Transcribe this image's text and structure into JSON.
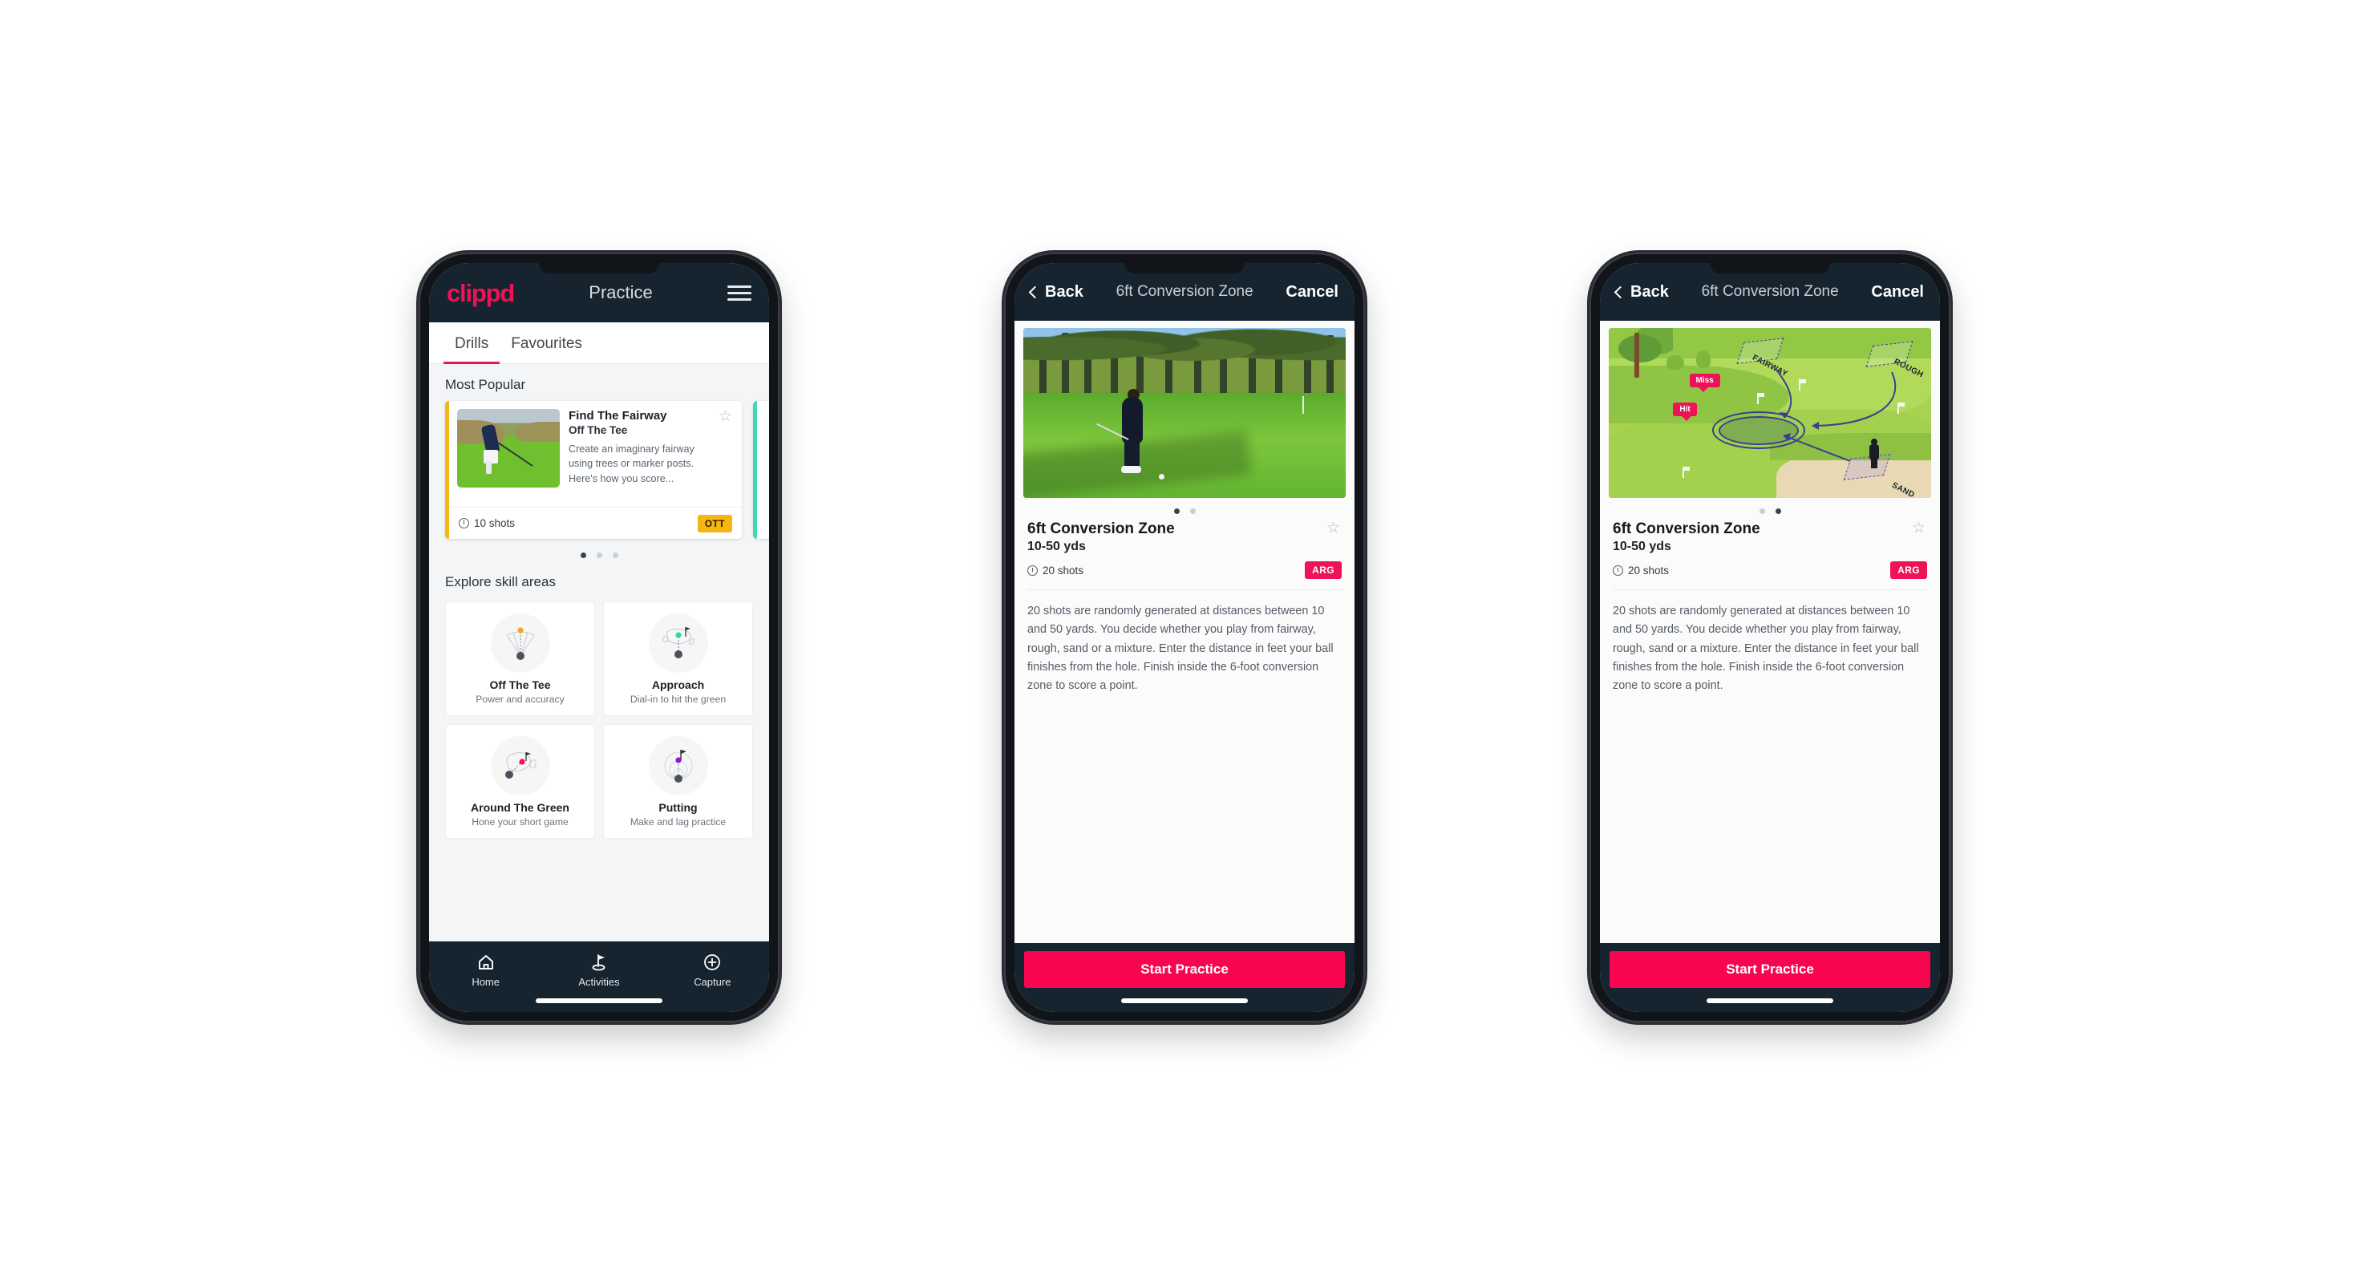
{
  "phone1": {
    "appbar": {
      "logo": "clippd",
      "title": "Practice",
      "menu_icon": "hamburger-icon"
    },
    "tabs": [
      {
        "label": "Drills",
        "active": true
      },
      {
        "label": "Favourites",
        "active": false
      }
    ],
    "sections": {
      "most_popular": "Most Popular",
      "explore": "Explore skill areas"
    },
    "drill_card": {
      "name": "Find The Fairway",
      "category": "Off The Tee",
      "description": "Create an imaginary fairway using trees or marker posts. Here's how you score...",
      "shots": "10 shots",
      "badge": "OTT",
      "accent_color": "#f5b513",
      "star_icon": "star-outline-icon"
    },
    "carousel_dots": [
      true,
      false,
      false
    ],
    "skills": [
      {
        "name": "Off The Tee",
        "sub": "Power and accuracy",
        "icon": "tee-fan-icon",
        "dot_color": "#f5a623"
      },
      {
        "name": "Approach",
        "sub": "Dial-in to hit the green",
        "icon": "approach-green-icon",
        "dot_color": "#33d6a6"
      },
      {
        "name": "Around The Green",
        "sub": "Hone your short game",
        "icon": "chip-green-icon",
        "dot_color": "#ee1356"
      },
      {
        "name": "Putting",
        "sub": "Make and lag practice",
        "icon": "putting-rings-icon",
        "dot_color": "#8c16d6"
      }
    ],
    "tabbar": [
      {
        "label": "Home",
        "icon": "home-icon",
        "active": false
      },
      {
        "label": "Activities",
        "icon": "golf-flag-icon",
        "active": true
      },
      {
        "label": "Capture",
        "icon": "plus-circle-icon",
        "active": false
      }
    ]
  },
  "detail": {
    "nav": {
      "back": "Back",
      "title": "6ft Conversion Zone",
      "cancel": "Cancel",
      "back_icon": "chevron-left-icon"
    },
    "title": "6ft Conversion Zone",
    "yards": "10-50 yds",
    "shots": "20 shots",
    "badge": "ARG",
    "star_icon": "star-outline-icon",
    "description": "20 shots are randomly generated at distances between 10 and 50 yards. You decide whether you play from fairway, rough, sand or a mixture. Enter the distance in feet your ball finishes from the hole. Finish inside the 6-foot conversion zone to score a point.",
    "cta": "Start Practice",
    "media_dots_phone2": [
      true,
      false
    ],
    "media_dots_phone3": [
      false,
      true
    ],
    "diagram": {
      "labels": [
        "FAIRWAY",
        "ROUGH",
        "SAND"
      ],
      "callouts": [
        "Miss",
        "Hit"
      ]
    }
  },
  "colors": {
    "brand_pink": "#ee1356",
    "cta_pink": "#f8054f",
    "navy": "#15242f",
    "ott_amber": "#f5b513",
    "teal": "#3fd9b0"
  }
}
